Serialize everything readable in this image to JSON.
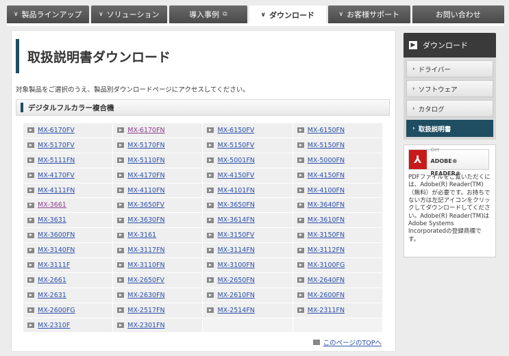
{
  "topnav": [
    {
      "label": "製品ラインアップ",
      "chevron": true,
      "ext": false,
      "active": false,
      "width": 120
    },
    {
      "label": "ソリューション",
      "chevron": true,
      "ext": false,
      "active": false,
      "width": 112
    },
    {
      "label": "導入事例",
      "chevron": false,
      "ext": true,
      "active": false,
      "width": 114
    },
    {
      "label": "ダウンロード",
      "chevron": true,
      "ext": false,
      "active": true,
      "width": 113
    },
    {
      "label": "お客様サポート",
      "chevron": true,
      "ext": false,
      "active": false,
      "width": 120
    },
    {
      "label": "お問い合わせ",
      "chevron": false,
      "ext": false,
      "active": false,
      "width": 135
    }
  ],
  "main": {
    "title": "取扱説明書ダウンロード",
    "intro": "対象製品をご選択のうえ、製品別ダウンロードページにアクセスしてください。",
    "section": "デジタルフルカラー複合機",
    "rows": [
      [
        "MX-6170FV",
        "MX-6170FN",
        "MX-6150FV",
        "MX-6150FN"
      ],
      [
        "MX-5170FV",
        "MX-5170FN",
        "MX-5150FV",
        "MX-5150FN"
      ],
      [
        "MX-5111FN",
        "MX-5110FN",
        "MX-5001FN",
        "MX-5000FN"
      ],
      [
        "MX-4170FV",
        "MX-4170FN",
        "MX-4150FV",
        "MX-4150FN"
      ],
      [
        "MX-4111FN",
        "MX-4110FN",
        "MX-4101FN",
        "MX-4100FN"
      ],
      [
        "MX-3661",
        "MX-3650FV",
        "MX-3650FN",
        "MX-3640FN"
      ],
      [
        "MX-3631",
        "MX-3630FN",
        "MX-3614FN",
        "MX-3610FN"
      ],
      [
        "MX-3600FN",
        "MX-3161",
        "MX-3150FV",
        "MX-3150FN"
      ],
      [
        "MX-3140FN",
        "MX-3117FN",
        "MX-3114FN",
        "MX-3112FN"
      ],
      [
        "MX-3111F",
        "MX-3110FN",
        "MX-3100FN",
        "MX-3100FG"
      ],
      [
        "MX-2661",
        "MX-2650FV",
        "MX-2650FN",
        "MX-2640FN"
      ],
      [
        "MX-2631",
        "MX-2630FN",
        "MX-2610FN",
        "MX-2600FN"
      ],
      [
        "MX-2600FG",
        "MX-2517FN",
        "MX-2514FN",
        "MX-2311FN"
      ],
      [
        "MX-2310F",
        "MX-2301FN",
        "",
        ""
      ]
    ],
    "visited": [
      "MX-6170FN",
      "MX-3661"
    ],
    "to_top": "このページのTOPへ"
  },
  "sidebar": {
    "head": "ダウンロード",
    "items": [
      {
        "label": "ドライバー",
        "active": false
      },
      {
        "label": "ソフトウェア",
        "active": false
      },
      {
        "label": "カタログ",
        "active": false
      },
      {
        "label": "取扱説明書",
        "active": true
      }
    ]
  },
  "adobe": {
    "get": "Get",
    "reader": "ADOBE® READER®",
    "description": "PDFファイルをご覧いただくには、Adobe(R) Reader(TM)（無料）が必要です。お持ちでない方は左記アイコンをクリックしてダウンロードしてください。Adobe(R) Reader(TM)はAdobe Systems Incorporatedの登録商標です。"
  }
}
